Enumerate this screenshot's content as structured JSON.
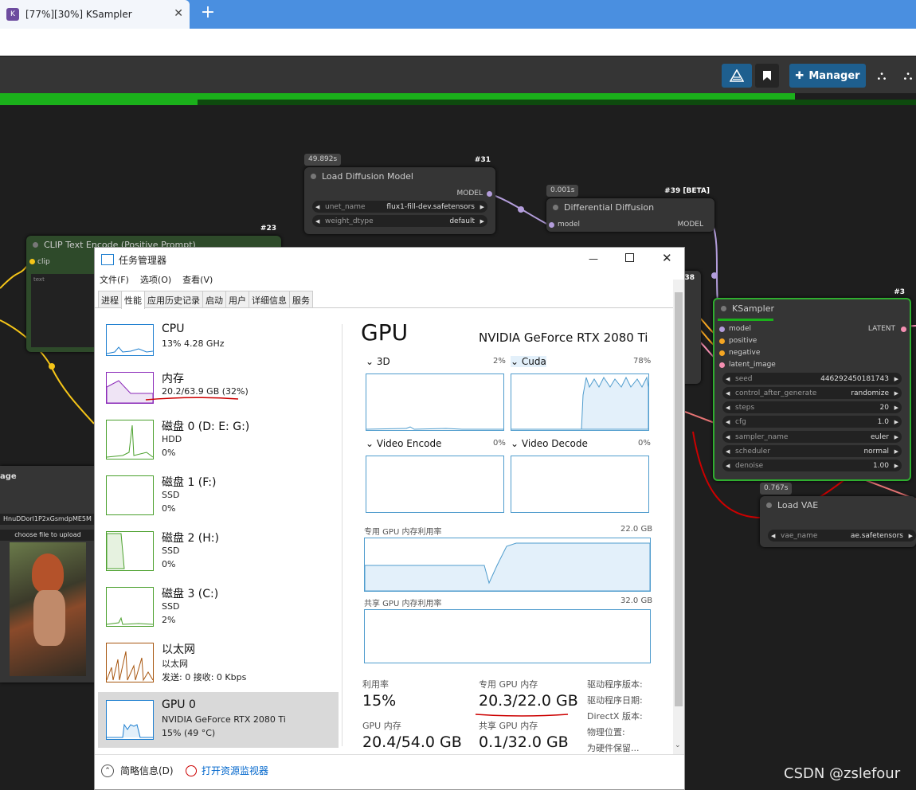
{
  "browser": {
    "tab_title": "[77%][30%] KSampler",
    "favicon_text": "K",
    "close_glyph": "✕",
    "new_tab_glyph": "+"
  },
  "comfy": {
    "manager_label": "Manager",
    "progress_percent": 77,
    "sub_progress_percent": 30,
    "nodes": {
      "load_diffusion": {
        "time": "49.892s",
        "id": "#31",
        "title": "Load Diffusion Model",
        "output": "MODEL",
        "unet_label": "unet_name",
        "unet_value": "flux1-fill-dev.safetensors",
        "dtype_label": "weight_dtype",
        "dtype_value": "default"
      },
      "diff_diffusion": {
        "time": "0.001s",
        "id": "#39 [BETA]",
        "title": "Differential Diffusion",
        "input": "model",
        "output": "MODEL"
      },
      "clip_encode": {
        "id": "#23",
        "title": "CLIP Text Encode (Positive Prompt)",
        "input": "clip",
        "text": "text"
      },
      "ksampler": {
        "id": "#3",
        "title": "KSampler",
        "inputs": [
          "model",
          "positive",
          "negative",
          "latent_image"
        ],
        "output": "LATENT",
        "widgets": [
          {
            "label": "seed",
            "value": "446292450181743"
          },
          {
            "label": "control_after_generate",
            "value": "randomize"
          },
          {
            "label": "steps",
            "value": "20"
          },
          {
            "label": "cfg",
            "value": "1.0"
          },
          {
            "label": "sampler_name",
            "value": "euler"
          },
          {
            "label": "scheduler",
            "value": "normal"
          },
          {
            "label": "denoise",
            "value": "1.00"
          }
        ]
      },
      "load_vae": {
        "time": "0.767s",
        "title": "Load VAE",
        "vae_label": "vae_name",
        "vae_value": "ae.safetensors"
      },
      "load_image": {
        "title": "age",
        "filename": "HnuDDorl1P2xGsmdpME5M",
        "upload_label": "choose file to upload"
      },
      "partial_id": "38"
    }
  },
  "taskmgr": {
    "title": "任务管理器",
    "menu": [
      "文件(F)",
      "选项(O)",
      "查看(V)"
    ],
    "tabs": [
      "进程",
      "性能",
      "应用历史记录",
      "启动",
      "用户",
      "详细信息",
      "服务"
    ],
    "active_tab": "性能",
    "resources": [
      {
        "name": "CPU",
        "line1": "13%  4.28 GHz",
        "line2": "",
        "color": "#1e7fd0"
      },
      {
        "name": "内存",
        "line1": "20.2/63.9 GB (32%)",
        "line2": "",
        "color": "#8a28b8"
      },
      {
        "name": "磁盘 0 (D: E: G:)",
        "line1": "HDD",
        "line2": "0%",
        "color": "#4aa02c"
      },
      {
        "name": "磁盘 1 (F:)",
        "line1": "SSD",
        "line2": "0%",
        "color": "#4aa02c"
      },
      {
        "name": "磁盘 2 (H:)",
        "line1": "SSD",
        "line2": "0%",
        "color": "#4aa02c"
      },
      {
        "name": "磁盘 3 (C:)",
        "line1": "SSD",
        "line2": "2%",
        "color": "#4aa02c"
      },
      {
        "name": "以太网",
        "line1": "以太网",
        "line2": "发送: 0  接收: 0 Kbps",
        "color": "#a7560f"
      },
      {
        "name": "GPU 0",
        "line1": "NVIDIA GeForce RTX 2080 Ti",
        "line2": "15% (49 °C)",
        "color": "#1e7fd0"
      }
    ],
    "gpu": {
      "heading": "GPU",
      "model": "NVIDIA GeForce RTX 2080 Ti",
      "engines": [
        {
          "name": "3D",
          "pct": "2%"
        },
        {
          "name": "Cuda",
          "pct": "78%"
        },
        {
          "name": "Video Encode",
          "pct": "0%"
        },
        {
          "name": "Video Decode",
          "pct": "0%"
        }
      ],
      "dedicated_label": "专用 GPU 内存利用率",
      "dedicated_max": "22.0 GB",
      "shared_label": "共享 GPU 内存利用率",
      "shared_max": "32.0 GB",
      "stats": {
        "util_label": "利用率",
        "util_value": "15%",
        "ded_label": "专用 GPU 内存",
        "ded_value": "20.3/22.0 GB",
        "gpumem_label": "GPU 内存",
        "gpumem_value": "20.4/54.0 GB",
        "shared_label": "共享 GPU 内存",
        "shared_value": "0.1/32.0 GB",
        "right_labels": [
          "驱动程序版本:",
          "驱动程序日期:",
          "DirectX 版本:",
          "物理位置:",
          "为硬件保留..."
        ]
      }
    },
    "footer": {
      "summary": "简略信息(D)",
      "monitor": "打开资源监视器"
    }
  },
  "watermark": "CSDN @zslefour"
}
